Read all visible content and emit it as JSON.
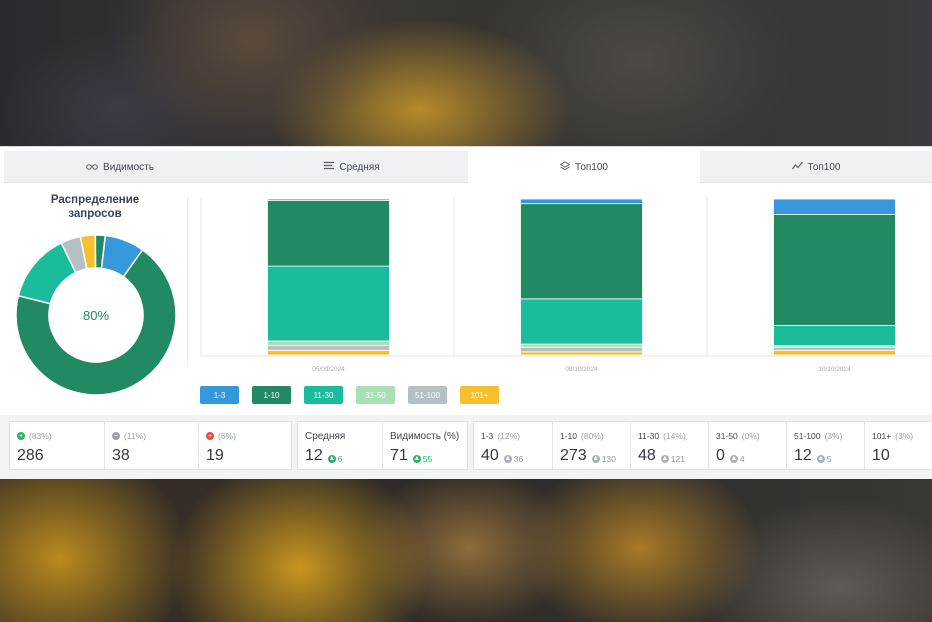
{
  "tabs": [
    {
      "label": "Видимость",
      "icon": "glasses-icon"
    },
    {
      "label": "Средняя",
      "icon": "lines-icon"
    },
    {
      "label": "Топ100",
      "icon": "layers-icon"
    },
    {
      "label": "Топ100",
      "icon": "trend-icon"
    }
  ],
  "active_tab": 2,
  "donut": {
    "title": "Распределение запросов",
    "center_label": "80%"
  },
  "legend": [
    {
      "label": "1-3",
      "color": "#3498db"
    },
    {
      "label": "1-10",
      "color": "#218a63"
    },
    {
      "label": "11-30",
      "color": "#1abc9c"
    },
    {
      "label": "31-50",
      "color": "#a8e0b4"
    },
    {
      "label": "51-100",
      "color": "#b5c0c5"
    },
    {
      "label": "101+",
      "color": "#f5c02b"
    }
  ],
  "stats": {
    "positions": [
      {
        "pct": "(83%)",
        "value": "286",
        "icon": "plus-icon",
        "color": "#2fb066"
      },
      {
        "pct": "(11%)",
        "value": "38",
        "icon": "minus-icon",
        "color": "#9aa1a8"
      },
      {
        "pct": "(6%)",
        "value": "19",
        "icon": "plus-icon",
        "color": "#e74c3c"
      }
    ],
    "metrics": [
      {
        "label": "Средняя",
        "value": "12",
        "delta": "6"
      },
      {
        "label": "Видимость (%)",
        "value": "71",
        "delta": "55"
      }
    ],
    "ranges": [
      {
        "label": "1-3",
        "pct": "(12%)",
        "value": "40",
        "delta": "36"
      },
      {
        "label": "1-10",
        "pct": "(80%)",
        "value": "273",
        "delta": "130"
      },
      {
        "label": "11-30",
        "pct": "(14%)",
        "value": "48",
        "delta": "121"
      },
      {
        "label": "31-50",
        "pct": "(0%)",
        "value": "0",
        "delta": "4"
      },
      {
        "label": "51-100",
        "pct": "(3%)",
        "value": "12",
        "delta": "5"
      },
      {
        "label": "101+",
        "pct": "(3%)",
        "value": "10",
        "delta": ""
      }
    ]
  },
  "chart_data": {
    "type": "bar",
    "stacked": true,
    "normalized": true,
    "categories": [
      "05/09/2024",
      "08/10/2024",
      "10/10/2024"
    ],
    "series": [
      {
        "name": "101+",
        "color": "#f5c02b",
        "values": [
          3,
          2,
          3
        ]
      },
      {
        "name": "51-100",
        "color": "#b5c0c5",
        "values": [
          3,
          3,
          2
        ]
      },
      {
        "name": "31-50",
        "color": "#a8e0b4",
        "values": [
          3,
          2,
          1
        ]
      },
      {
        "name": "11-30",
        "color": "#1abc9c",
        "values": [
          48,
          29,
          13
        ]
      },
      {
        "name": "1-10",
        "color": "#218a63",
        "values": [
          42,
          61,
          71
        ]
      },
      {
        "name": "1-3",
        "color": "#3498db",
        "values": [
          1,
          3,
          10
        ]
      }
    ],
    "ylim": [
      0,
      100
    ],
    "grid": false
  },
  "donut_data": {
    "type": "pie",
    "segments": [
      {
        "name": "1-10",
        "value": 69,
        "color": "#218a63"
      },
      {
        "name": "11-30",
        "value": 14,
        "color": "#1abc9c"
      },
      {
        "name": "51-100",
        "value": 4,
        "color": "#b5c0c5"
      },
      {
        "name": "101+",
        "value": 3,
        "color": "#f5c02b"
      },
      {
        "name": "1-10 top",
        "value": 2,
        "color": "#218a63"
      },
      {
        "name": "1-3",
        "value": 8,
        "color": "#3498db"
      }
    ]
  }
}
